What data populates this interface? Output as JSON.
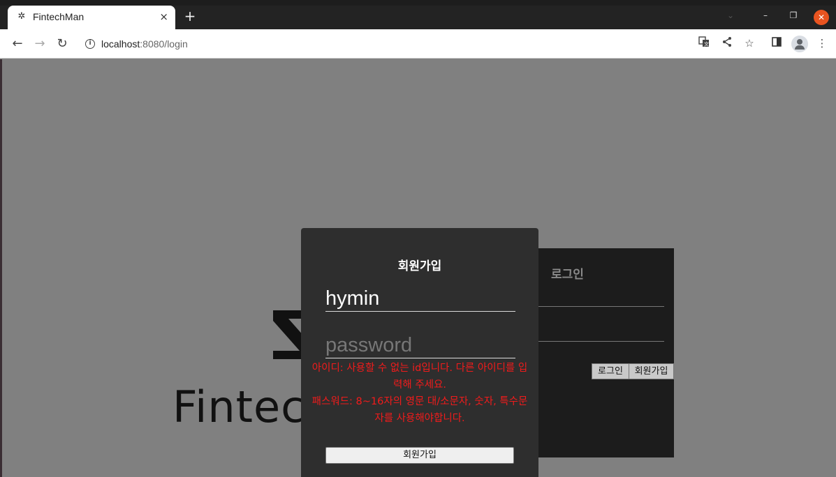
{
  "browser": {
    "tab_title": "FintechMan",
    "tab_favicon": "✲",
    "tab_close": "×",
    "new_tab": "+",
    "url_host": "localhost",
    "url_rest": ":8080/login",
    "icons": {
      "back": "back-arrow-icon",
      "forward": "forward-arrow-icon",
      "reload": "reload-icon",
      "translate": "translate-icon",
      "share": "share-icon",
      "bookmark": "star-icon",
      "sidepanel": "side-panel-icon",
      "profile": "profile-icon",
      "menu": "kebab-menu-icon"
    },
    "window": {
      "close_color": "#e95420"
    }
  },
  "page": {
    "background": "#808080",
    "logo_text": "Fintec"
  },
  "login": {
    "heading": "로그인",
    "login_button": "로그인",
    "signup_button": "회원가입"
  },
  "signup": {
    "heading": "회원가입",
    "id_value": "hymin",
    "password_placeholder": "password",
    "error_id": "아이디: 사용할 수 없는 id입니다. 다른 아이디를 입력해 주세요.",
    "error_password": "패스워드: 8~16자의 영문 대/소문자, 숫자, 특수문자를 사용해야합니다.",
    "error_color": "#f21b1b",
    "submit_button": "회원가입"
  }
}
